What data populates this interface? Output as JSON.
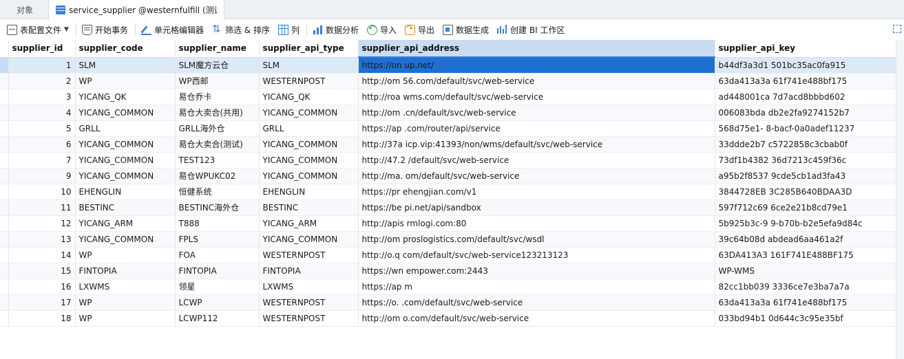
{
  "tabs": {
    "objects_label": "对象",
    "active_title": "service_supplier @westernfulfill (测试..."
  },
  "toolbar": {
    "table_config": "表配置文件",
    "begin_txn": "开始事务",
    "cell_editor": "单元格编辑器",
    "filter_sort": "筛选 & 排序",
    "columns": "列",
    "data_analysis": "数据分析",
    "import": "导入",
    "export": "导出",
    "data_gen": "数据生成",
    "create_bi": "创建 BI 工作区"
  },
  "grid": {
    "columns": [
      "supplier_id",
      "supplier_code",
      "supplier_name",
      "supplier_api_type",
      "supplier_api_address",
      "supplier_api_key"
    ],
    "rows": [
      [
        "1",
        "SLM",
        "SLM魔方云仓",
        "SLM",
        "https://on  up.net/",
        "b44df3a3d1  501bc35ac0fa915"
      ],
      [
        "2",
        "WP",
        "WP西邮",
        "WESTERNPOST",
        "http://om  56.com/default/svc/web-service",
        "63da413a3a  61f741e488bf175"
      ],
      [
        "3",
        "YICANG_QK",
        "易仓乔卡",
        "YICANG_QK",
        "http://roa  wms.com/default/svc/web-service",
        "ad448001ca  7d7acd8bbbd602"
      ],
      [
        "4",
        "YICANG_COMMON",
        "易仓大卖合(共用)",
        "YICANG_COMMON",
        "http://om  .cn/default/svc/web-service",
        "006083bda  db2e2fa9274152b7"
      ],
      [
        "5",
        "GRLL",
        "GRLL海外仓",
        "GRLL",
        "https://ap  .com/router/api/service",
        "568d75e1-  8-bacf-0a0adef11237"
      ],
      [
        "6",
        "YICANG_COMMON",
        "易仓大卖合(测试)",
        "YICANG_COMMON",
        "http://37a  icp.vip:41393/non/wms/default/svc/web-service",
        "33ddde2b7  c5722858c3cbab0f"
      ],
      [
        "7",
        "YICANG_COMMON",
        "TEST123",
        "YICANG_COMMON",
        "http://47.2  /default/svc/web-service",
        "73df1b4382  36d7213c459f36c"
      ],
      [
        "9",
        "YICANG_COMMON",
        "易仓WPUKC02",
        "YICANG_COMMON",
        "http://ma.  om/default/svc/web-service",
        "a95b2f8537  9cde5cb1ad3fa43"
      ],
      [
        "10",
        "EHENGLIN",
        "恒健系统",
        "EHENGLIN",
        "https://pr  ehengjian.com/v1",
        "3844728EB  3C285B640BDAA3D"
      ],
      [
        "11",
        "BESTINC",
        "BESTINC海外仓",
        "BESTINC",
        "https://be  pi.net/api/sandbox",
        "597f712c69  6ce2e21b8cd79e1"
      ],
      [
        "12",
        "YICANG_ARM",
        "T888",
        "YICANG_ARM",
        "http://apis  rmlogi.com:80",
        "5b925b3c-9  9-b70b-b2e5efa9d84c"
      ],
      [
        "13",
        "YICANG_COMMON",
        "FPLS",
        "YICANG_COMMON",
        "http://om  proslogistics.com/default/svc/wsdl",
        "39c64b08d  abdead6aa461a2f"
      ],
      [
        "14",
        "WP",
        "FOA",
        "WESTERNPOST",
        "http://o.q  com/default/svc/web-service123213123",
        "63DA413A3  161F741E488BF175"
      ],
      [
        "15",
        "FINTOPIA",
        "FINTOPIA",
        "FINTOPIA",
        "https://wn  empower.com:2443",
        "WP-WMS"
      ],
      [
        "16",
        "LXWMS",
        "领星",
        "LXWMS",
        "https://ap  m",
        "82cc1bb039  3336ce7e3ba7a7a"
      ],
      [
        "17",
        "WP",
        "LCWP",
        "WESTERNPOST",
        "https://o.  .com/default/svc/web-service",
        "63da413a3a  61f741e488bf175"
      ],
      [
        "18",
        "WP",
        "LCWP112",
        "WESTERNPOST",
        "http://om  o.com/default/svc/web-service",
        "033bd94b1  0d644c3c95e35bf"
      ]
    ]
  },
  "colors": {
    "accent": "#3b7fd8",
    "selected_cell": "#1f6fd1",
    "selected_row": "#dceaf8",
    "header_selected": "#c9dcf1"
  },
  "icons": [
    "table-icon",
    "form-config-icon",
    "transaction-icon",
    "cell-editor-icon",
    "filter-sort-icon",
    "columns-icon",
    "data-analysis-icon",
    "import-icon",
    "export-icon",
    "data-generation-icon",
    "bi-workspace-icon",
    "expand-icon"
  ]
}
